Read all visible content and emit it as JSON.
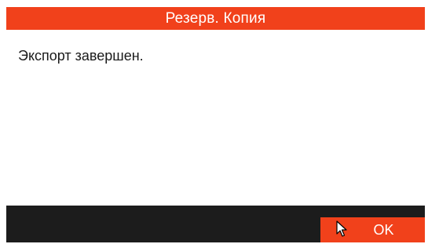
{
  "dialog": {
    "title": "Резерв. Копия",
    "message": "Экспорт завершен.",
    "ok_label": "OK"
  },
  "icons": {
    "cursor": "mouse-pointer-icon"
  },
  "colors": {
    "accent": "#f1411b",
    "footer": "#1c1c1c",
    "background": "#ffffff"
  }
}
